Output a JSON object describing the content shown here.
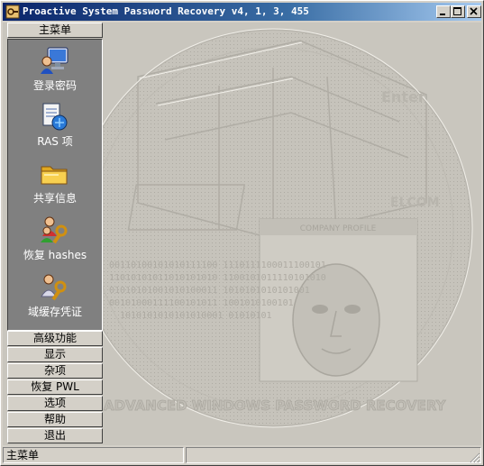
{
  "window": {
    "title": "Proactive System Password Recovery v4, 1, 3, 455"
  },
  "sidebar": {
    "main_menu_label": "主菜单",
    "items": [
      {
        "label": "登录密码",
        "icon": "monitor-user-icon"
      },
      {
        "label": "RAS 项",
        "icon": "document-network-icon"
      },
      {
        "label": "共享信息",
        "icon": "shared-folder-icon"
      },
      {
        "label": "恢复 hashes",
        "icon": "users-key-icon"
      },
      {
        "label": "域缓存凭证",
        "icon": "user-key-icon"
      }
    ],
    "categories": [
      "高级功能",
      "显示",
      "杂项",
      "恢复 PWL",
      "选项",
      "帮助",
      "退出"
    ]
  },
  "background": {
    "company_profile_text": "COMPANY PROFILE",
    "bottom_text": "ADVANCED WINDOWS PASSWORD RECOVERY",
    "brand_text": "ELCOM",
    "enter_text": "Enter",
    "binary_lines": [
      "00110100101010111100 1110111100011100101",
      "11010101011010101010 1100101011110101010",
      "01010101001010100011 1010101010101001",
      "00101000111100101011 1001010100101",
      "1010101010101010001 01010101"
    ]
  },
  "statusbar": {
    "text": "主菜单"
  },
  "colors": {
    "title_start": "#0a246a",
    "title_end": "#a6caf0",
    "panel_bg": "#808080",
    "face": "#d4d0c8"
  }
}
